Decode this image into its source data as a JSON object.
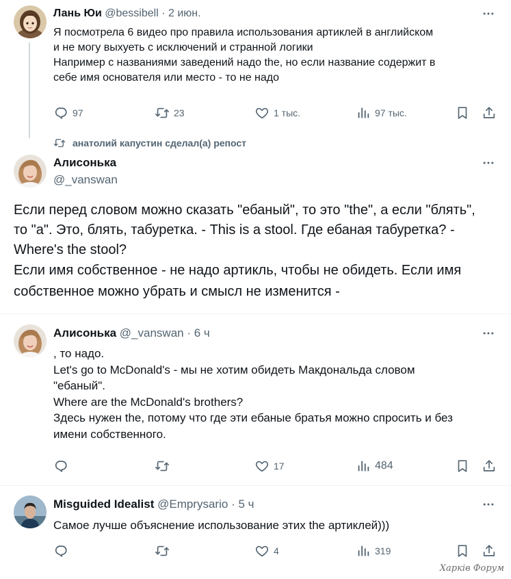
{
  "tweet1": {
    "name": "Лань Юи",
    "handle": "@bessibell",
    "dot": "·",
    "time": "2 июн.",
    "lines": [
      "Я посмотрела 6 видео про правила использования артиклей в английском",
      "и не могу выхуеть с исключений и странной логики",
      "Например с названиями заведений надо the, но если название содержит в",
      "себе имя основателя или место - то не надо"
    ],
    "replies": "97",
    "reposts": "23",
    "likes": "1 тыс.",
    "views": "97 тыс."
  },
  "repost_banner": "анатолий капустин сделал(а) репост",
  "tweet2": {
    "name": "Алисонька",
    "handle": "@_vanswan",
    "lines": [
      "Если перед словом можно сказать \"ебаный\", то это \"the\", а если \"блять\",",
      "то \"a\". Это, блять, табуретка. - This is a stool. Где ебаная табуретка? -",
      "Where's the stool?",
      "Если имя собственное - не надо артикль, чтобы не обидеть. Если имя",
      "собственное можно убрать и смысл не изменится -"
    ]
  },
  "tweet3": {
    "name": "Алисонька",
    "handle": "@_vanswan",
    "dot": "·",
    "time": "6 ч",
    "lines": [
      ", то надо.",
      "Let's go to McDonald's - мы не хотим обидеть Макдональда словом",
      "\"ебаный\".",
      "Where are the McDonald's brothers?",
      "Здесь нужен the, потому что где эти ебаные братья можно спросить и без",
      "имени собственного."
    ],
    "likes": "17",
    "views": "484"
  },
  "tweet4": {
    "name": "Misguided Idealist",
    "handle": "@Emprysario",
    "dot": "·",
    "time": "5 ч",
    "lines": [
      "Самое лучше объяснение использование этих the артиклей)))"
    ],
    "likes": "4",
    "views": "319"
  },
  "watermark": "Харків Форум",
  "icons": {
    "more": "more-horizontal-icon",
    "reply": "reply-icon",
    "repost": "repost-icon",
    "like": "heart-icon",
    "views": "views-icon",
    "bookmark": "bookmark-icon",
    "share": "share-icon"
  },
  "colors": {
    "text": "#0f1419",
    "secondary": "#536471",
    "divider": "#eff3f4",
    "thread_line": "#cfd9de"
  }
}
